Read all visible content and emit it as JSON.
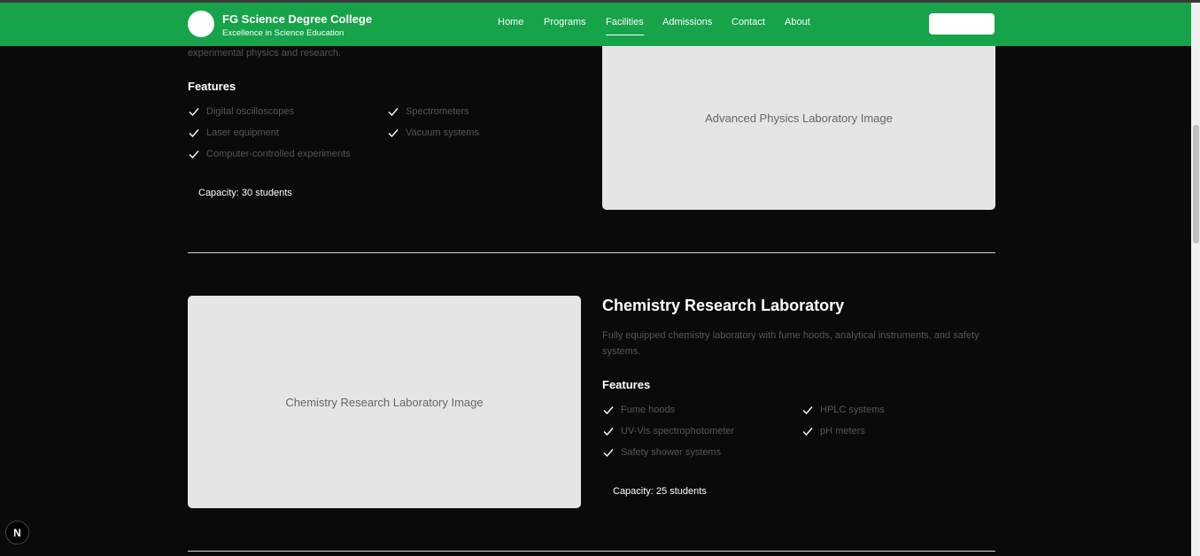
{
  "header": {
    "college_name": "FG Science Degree College",
    "tagline": "Excellence in Science Education",
    "nav": [
      "Home",
      "Programs",
      "Facilities",
      "Admissions",
      "Contact",
      "About"
    ],
    "active_nav": "Facilities",
    "cta_label": ""
  },
  "physics_lab": {
    "description_tail": "experimental physics and research.",
    "features_heading": "Features",
    "features": [
      "Digital oscilloscopes",
      "Spectrometers",
      "Laser equipment",
      "Vacuum systems",
      "Computer-controlled experiments"
    ],
    "capacity": "Capacity: 30 students",
    "image_label": "Advanced Physics Laboratory Image"
  },
  "chemistry_lab": {
    "title": "Chemistry Research Laboratory",
    "description": "Fully equipped chemistry laboratory with fume hoods, analytical instruments, and safety systems.",
    "features_heading": "Features",
    "features": [
      "Fume hoods",
      "HPLC systems",
      "UV-Vis spectrophotometer",
      "pH meters",
      "Safety shower systems"
    ],
    "capacity": "Capacity: 25 students",
    "image_label": "Chemistry Research Laboratory Image"
  },
  "dev_badge": "N",
  "colors": {
    "brand_green": "#16a34a",
    "background": "#0a0a0a",
    "image_placeholder": "#e5e5e5"
  }
}
